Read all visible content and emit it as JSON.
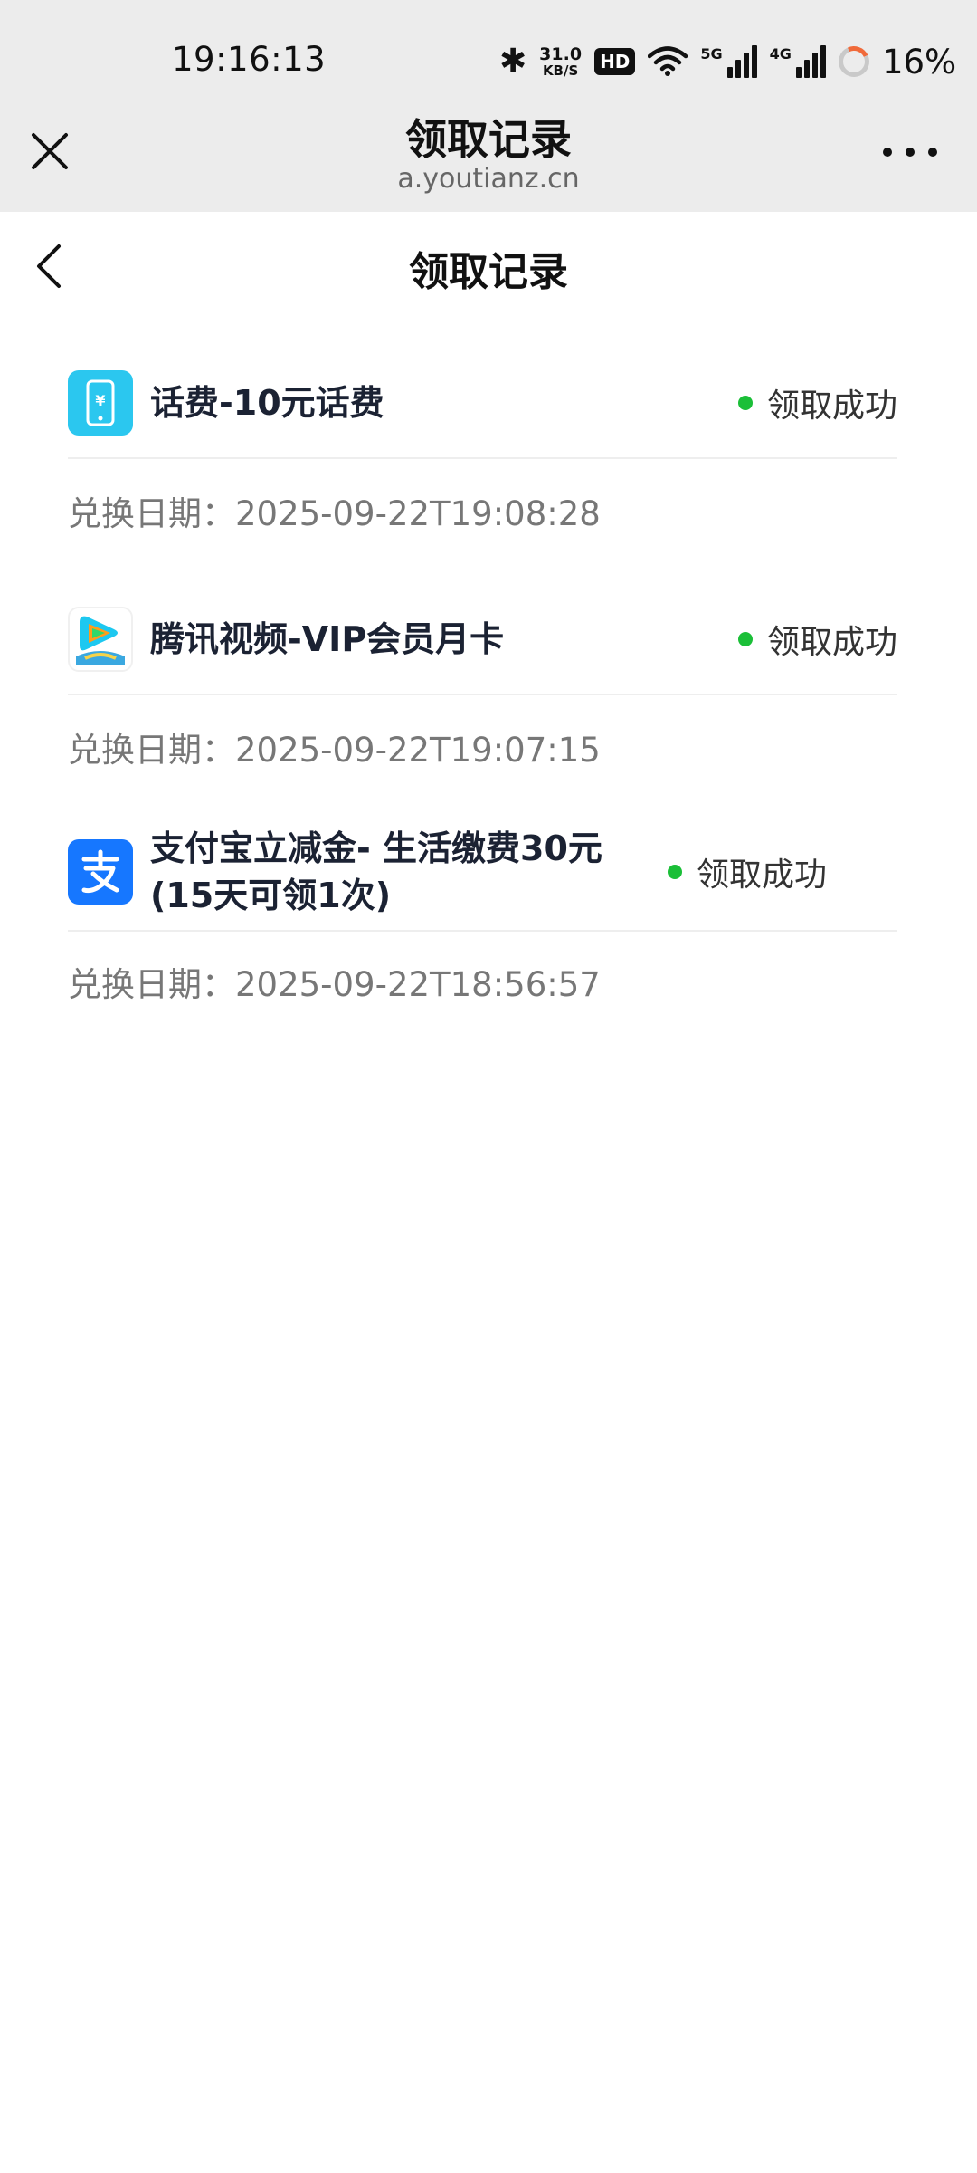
{
  "status_bar": {
    "time": "19:16:13",
    "net_speed_value": "31.0",
    "net_speed_unit": "KB/S",
    "hd_badge": "HD",
    "signal_5g_label": "5G",
    "signal_4g_label": "4G",
    "battery_percent": "16%"
  },
  "browser_header": {
    "title": "领取记录",
    "url": "a.youtianz.cn"
  },
  "nav": {
    "title": "领取记录"
  },
  "records": [
    {
      "title": "话费-10元话费",
      "status": "领取成功",
      "date_label": "兑换日期：",
      "date": "2025-09-22T19:08:28",
      "icon": "phone-recharge-icon"
    },
    {
      "title": "腾讯视频-VIP会员月卡",
      "status": "领取成功",
      "date_label": "兑换日期：",
      "date": "2025-09-22T19:07:15",
      "icon": "tencent-video-icon"
    },
    {
      "title": "支付宝立减金- 生活缴费30元(15天可领1次)",
      "status": "领取成功",
      "date_label": "兑换日期：",
      "date": "2025-09-22T18:56:57",
      "icon": "alipay-icon"
    }
  ],
  "colors": {
    "header_bg": "#ececec",
    "status_success": "#1bbf38",
    "alipay_blue": "#1677ff",
    "phone_icon_bg": "#2bc7ef"
  }
}
